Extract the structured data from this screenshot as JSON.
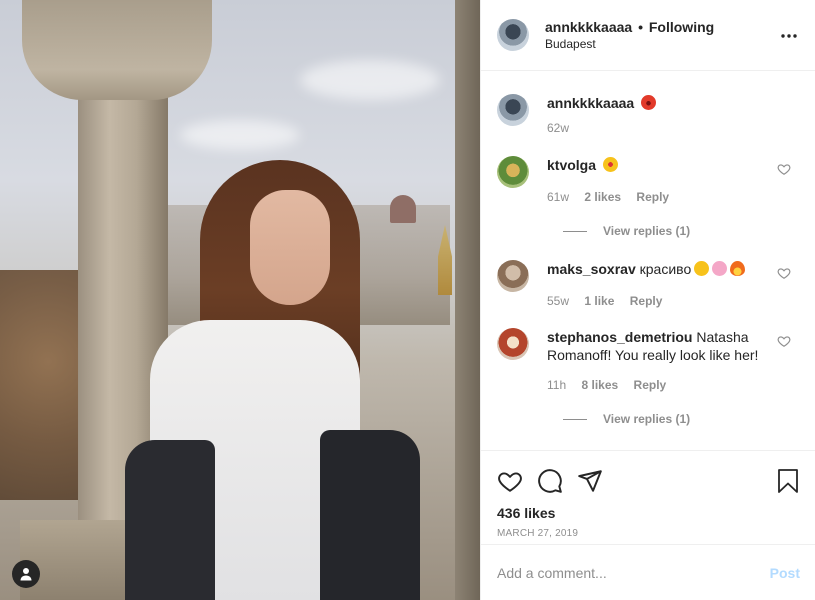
{
  "post": {
    "username": "annkkkkaaaa",
    "separator": "•",
    "follow_status": "Following",
    "location": "Budapest",
    "more_icon": "more-horizontal-icon"
  },
  "caption": {
    "username": "annkkkkaaaa",
    "emoji": "angry-face-emoji",
    "time": "62w"
  },
  "comments": [
    {
      "username": "ktvolga",
      "text": "",
      "emojis": [
        "star-struck-emoji"
      ],
      "time": "61w",
      "likes": "2 likes",
      "reply_label": "Reply",
      "view_replies": "View replies (1)"
    },
    {
      "username": "maks_soxrav",
      "text": "красиво",
      "emojis": [
        "smiling-halo-emoji",
        "blossom-emoji",
        "fire-emoji"
      ],
      "time": "55w",
      "likes": "1 like",
      "reply_label": "Reply"
    },
    {
      "username": "stephanos_demetriou",
      "text": "Natasha Romanoff! You really look like her!",
      "time": "11h",
      "likes": "8 likes",
      "reply_label": "Reply",
      "view_replies": "View replies (1)"
    }
  ],
  "engagement": {
    "likes": "436 likes",
    "date": "MARCH 27, 2019"
  },
  "add_comment": {
    "placeholder": "Add a comment...",
    "post_label": "Post"
  },
  "colors": {
    "text": "#262626",
    "secondary": "#8e8e8e",
    "post_disabled": "#b3dbff",
    "divider": "#efefef"
  }
}
